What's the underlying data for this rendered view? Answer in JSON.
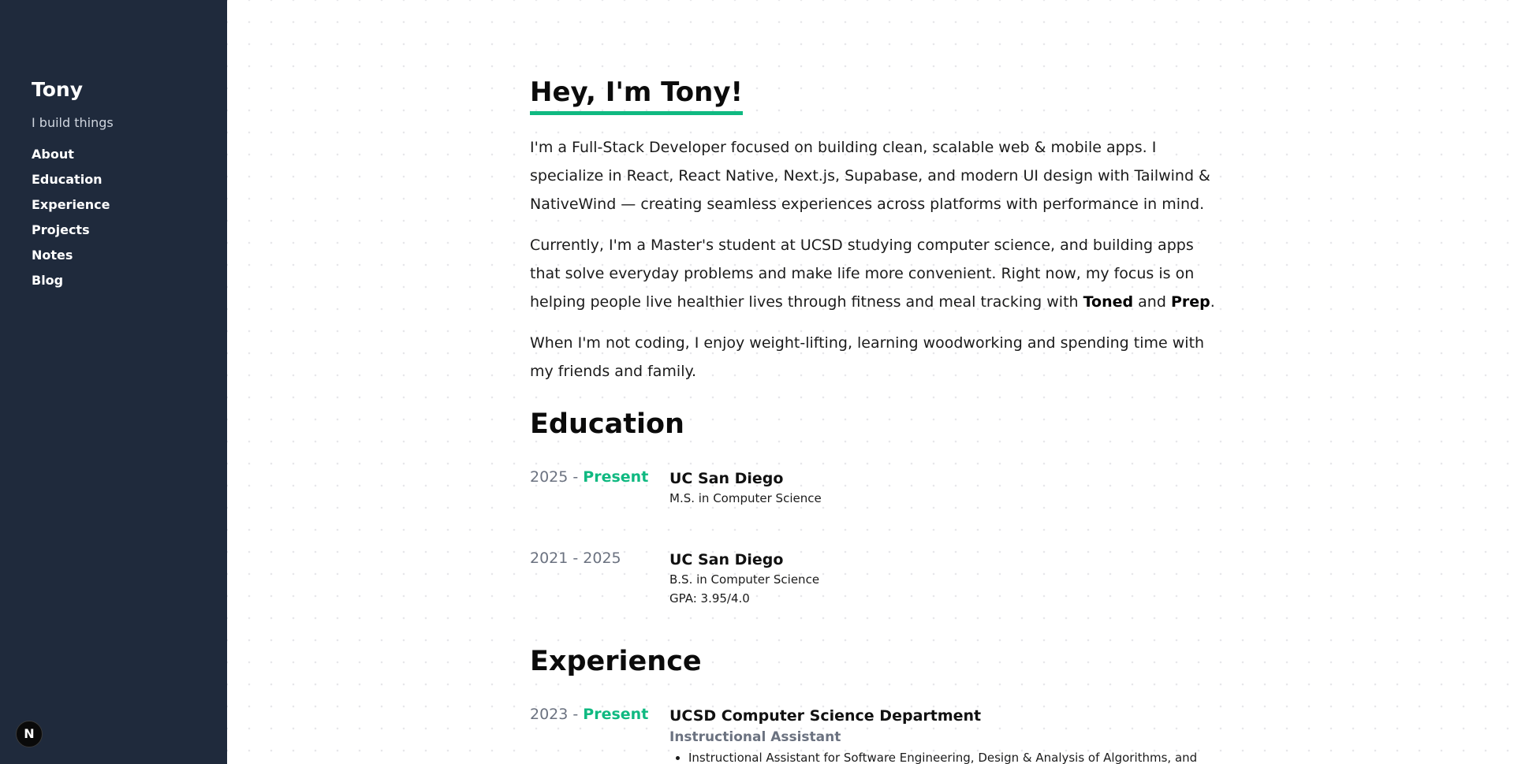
{
  "sidebar": {
    "brand": "Tony",
    "tagline": "I build things",
    "nav": [
      "About",
      "Education",
      "Experience",
      "Projects",
      "Notes",
      "Blog"
    ],
    "badge": "N"
  },
  "hero": {
    "title": "Hey, I'm Tony!",
    "p1": "I'm a Full-Stack Developer focused on building clean, scalable web & mobile apps. I specialize in React, React Native, Next.js, Supabase, and modern UI design with Tailwind & NativeWind — creating seamless experiences across platforms with performance in mind.",
    "p2_a": "Currently, I'm a Master's student at UCSD studying computer science, and building apps that solve everyday problems and make life more convenient. Right now, my focus is on helping people live healthier lives through fitness and meal tracking with ",
    "p2_b": "Toned",
    "p2_c": " and ",
    "p2_d": "Prep",
    "p2_e": ".",
    "p3": "When I'm not coding, I enjoy weight-lifting, learning woodworking and spending time with my friends and family."
  },
  "education": {
    "heading": "Education",
    "entries": [
      {
        "start": "2025",
        "sep": " - ",
        "end": "Present",
        "org": "UC San Diego",
        "lines": [
          "M.S. in Computer Science"
        ]
      },
      {
        "start": "2021",
        "sep": " - ",
        "end": "2025",
        "org": "UC San Diego",
        "lines": [
          "B.S. in Computer Science",
          "GPA: 3.95/4.0"
        ]
      }
    ]
  },
  "experience": {
    "heading": "Experience",
    "entries": [
      {
        "start": "2023",
        "sep": " - ",
        "end": "Present",
        "org": "UCSD Computer Science Department",
        "role": "Instructional Assistant",
        "bullets": [
          "Instructional Assistant for Software Engineering, Design & Analysis of Algorithms, and"
        ]
      }
    ]
  },
  "colors": {
    "accent": "#10b981",
    "sidebar_bg": "#1f2a3c",
    "muted": "#6b7280"
  }
}
